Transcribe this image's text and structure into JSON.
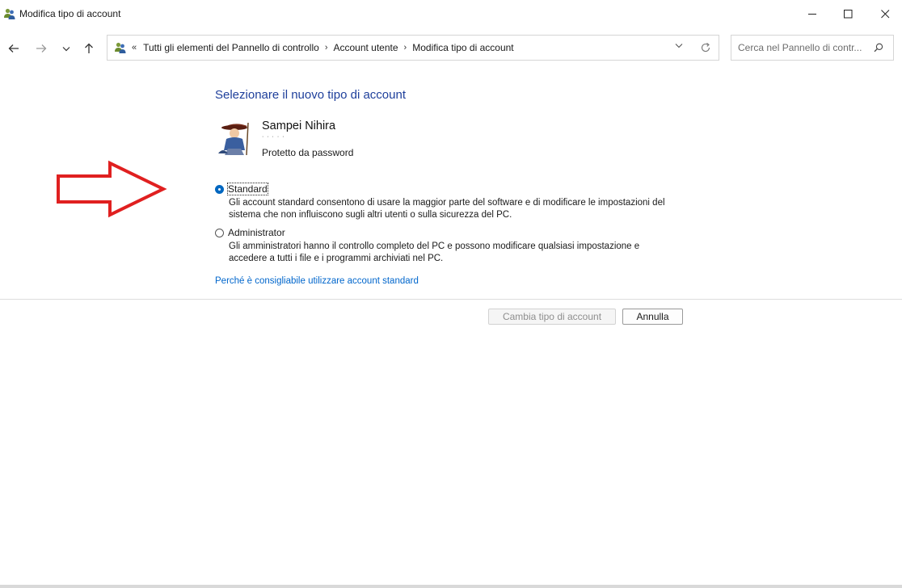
{
  "window": {
    "title": "Modifica tipo di account"
  },
  "address": {
    "overflow": "«",
    "crumbs": [
      "Tutti gli elementi del Pannello di controllo",
      "Account utente",
      "Modifica tipo di account"
    ]
  },
  "search": {
    "placeholder": "Cerca nel Pannello di contr..."
  },
  "main": {
    "heading": "Selezionare il nuovo tipo di account",
    "user": {
      "name": "Sampei Nihira",
      "status": "Protetto da password"
    },
    "options": [
      {
        "label": "Standard",
        "selected": true,
        "desc_lines": [
          "Gli account standard consentono di usare la maggior parte del software e di modificare le impostazioni del",
          "sistema che non influiscono sugli altri utenti o sulla sicurezza del PC."
        ]
      },
      {
        "label": "Administrator",
        "selected": false,
        "desc_lines": [
          "Gli amministratori hanno il controllo completo del PC e possono modificare qualsiasi impostazione e",
          "accedere a tutti i file e i programmi archiviati nel PC."
        ]
      }
    ],
    "link": "Perché è consigliabile utilizzare account standard"
  },
  "buttons": {
    "change": "Cambia tipo di account",
    "cancel": "Annulla"
  },
  "colors": {
    "heading": "#1e3f9b",
    "link": "#0066cc",
    "radio_selected": "#0067c0",
    "annotation_arrow": "#e02020"
  },
  "icons": {
    "window": "users-icon",
    "back": "arrow-left-icon",
    "forward": "arrow-right-icon",
    "recent": "chevron-down-icon",
    "up": "arrow-up-icon",
    "refresh": "refresh-icon",
    "search": "search-icon"
  }
}
